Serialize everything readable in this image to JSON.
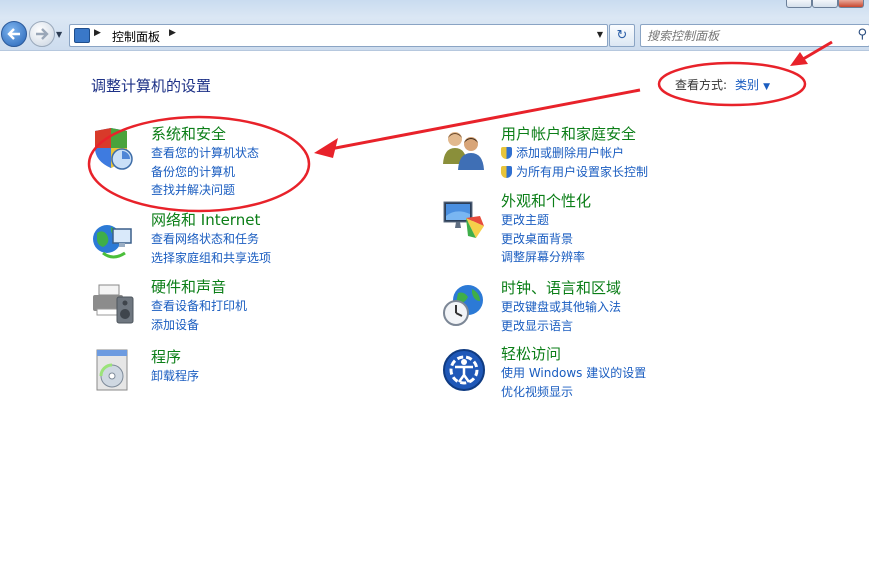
{
  "address_bar": {
    "breadcrumb": "控制面板",
    "search_placeholder": "搜索控制面板"
  },
  "header": {
    "title": "调整计算机的设置",
    "view_by_label": "查看方式:",
    "view_by_value": "类别"
  },
  "categories": [
    {
      "title": "系统和安全",
      "icon": "shield-computer-icon",
      "links": [
        "查看您的计算机状态",
        "备份您的计算机",
        "查找并解决问题"
      ]
    },
    {
      "title": "网络和 Internet",
      "icon": "globe-network-icon",
      "links": [
        "查看网络状态和任务",
        "选择家庭组和共享选项"
      ]
    },
    {
      "title": "硬件和声音",
      "icon": "printer-speaker-icon",
      "links": [
        "查看设备和打印机",
        "添加设备"
      ]
    },
    {
      "title": "程序",
      "icon": "program-disk-icon",
      "links": [
        "卸载程序"
      ]
    },
    {
      "title": "用户帐户和家庭安全",
      "icon": "users-icon",
      "links": [
        "添加或删除用户帐户",
        "为所有用户设置家长控制"
      ]
    },
    {
      "title": "外观和个性化",
      "icon": "monitor-palette-icon",
      "links": [
        "更改主题",
        "更改桌面背景",
        "调整屏幕分辨率"
      ]
    },
    {
      "title": "时钟、语言和区域",
      "icon": "clock-globe-icon",
      "links": [
        "更改键盘或其他输入法",
        "更改显示语言"
      ]
    },
    {
      "title": "轻松访问",
      "icon": "ease-of-access-icon",
      "links": [
        "使用 Windows 建议的设置",
        "优化视频显示"
      ]
    }
  ],
  "colors": {
    "title_green": "#0b7e17",
    "link_blue": "#1a5dc0",
    "annotation_red": "#e8222a"
  }
}
